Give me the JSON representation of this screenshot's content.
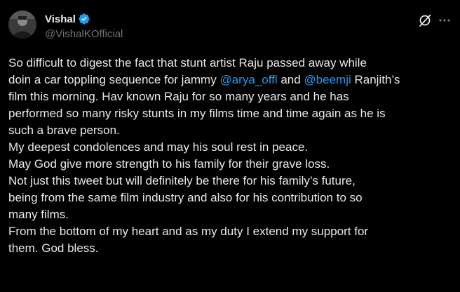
{
  "author": {
    "display_name": "Vishal",
    "handle": "@VishalKOfficial",
    "verified": true
  },
  "tweet": {
    "line1": "So difficult to digest the fact that stunt artist Raju passed away while",
    "line2_pre": "doin a car toppling sequence for jammy ",
    "mention1": "@arya_offl",
    "line2_mid": " and ",
    "mention2": "@beemji",
    "line2_post": " Ranjith’s",
    "line3": "film this morning. Hav known Raju for so many years and he has",
    "line4": "performed so many risky stunts in my films time and time again as he is",
    "line5": "such a brave person.",
    "line6": "My deepest condolences and may his soul rest in peace.",
    "line7": "May God give more strength to his family for their grave loss.",
    "line8": "Not just this tweet but will definitely be there for his family’s future,",
    "line9": "being from the same film industry and also for his contribution to so",
    "line10": "many films.",
    "line11": "From the bottom of my heart and as my duty I extend my support for",
    "line12": "them.  God bless."
  },
  "icons": {
    "avatar": "profile-photo",
    "verified": "verified-badge-icon",
    "grok": "grok-icon",
    "more": "more-options-icon"
  },
  "colors": {
    "background": "#000000",
    "text": "#e7e9ea",
    "secondary": "#71767b",
    "link": "#1d9bf0"
  }
}
